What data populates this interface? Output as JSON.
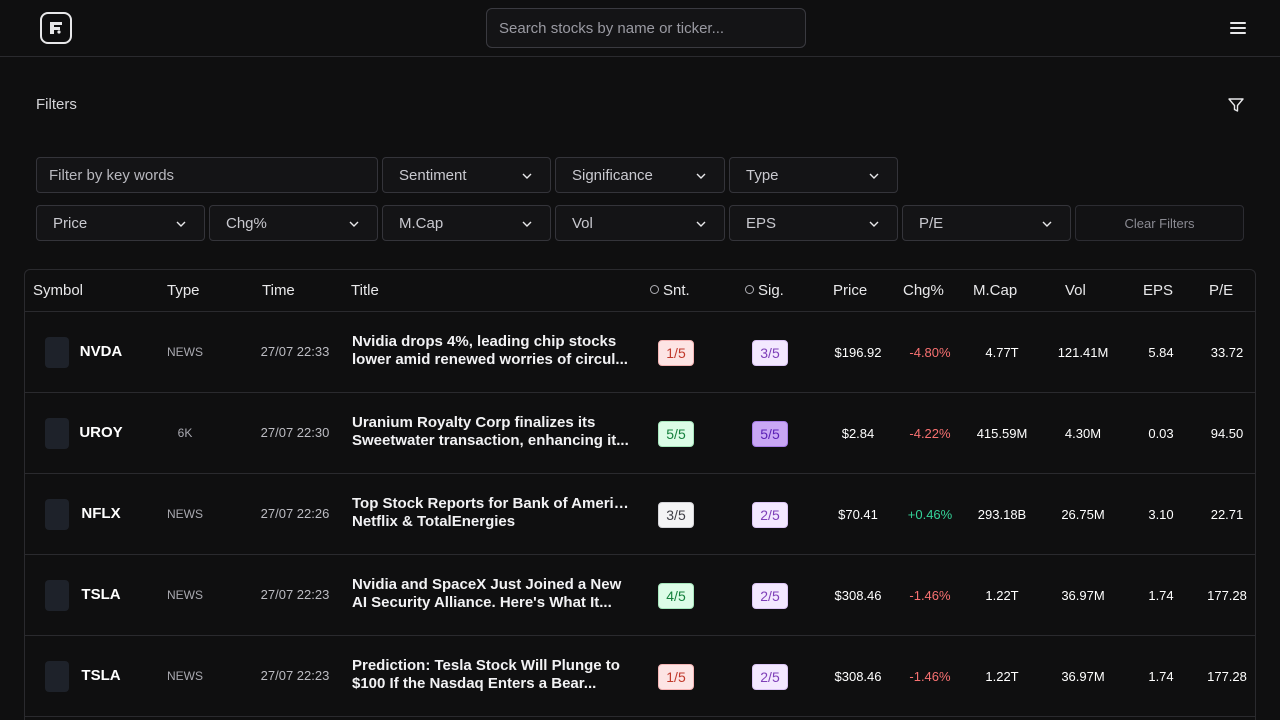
{
  "header": {
    "search_placeholder": "Search stocks by name or ticker...",
    "logo_icon": "app-logo-icon",
    "menu_icon": "hamburger-menu-icon"
  },
  "filters": {
    "title": "Filters",
    "keyword_placeholder": "Filter by key words",
    "dropdowns_row1": [
      "Sentiment",
      "Significance",
      "Type"
    ],
    "dropdowns_row2": [
      "Price",
      "Chg%",
      "M.Cap",
      "Vol",
      "EPS",
      "P/E"
    ],
    "clear_label": "Clear Filters"
  },
  "table": {
    "columns": [
      "Symbol",
      "Type",
      "Time",
      "Title",
      "Snt.",
      "Sig.",
      "Price",
      "Chg%",
      "M.Cap",
      "Vol",
      "EPS",
      "P/E"
    ],
    "rows": [
      {
        "symbol": "NVDA",
        "type": "NEWS",
        "time": "27/07 22:33",
        "title1": "Nvidia drops 4%, leading chip stocks",
        "title2": "lower amid renewed worries of circul...",
        "snt": "1/5",
        "sig": "3/5",
        "price": "$196.92",
        "chg": "-4.80%",
        "mcap": "4.77T",
        "vol": "121.41M",
        "eps": "5.84",
        "pe": "33.72"
      },
      {
        "symbol": "UROY",
        "type": "6K",
        "time": "27/07 22:30",
        "title1": "Uranium Royalty Corp finalizes its",
        "title2": "Sweetwater transaction, enhancing it...",
        "snt": "5/5",
        "sig": "5/5",
        "price": "$2.84",
        "chg": "-4.22%",
        "mcap": "415.59M",
        "vol": "4.30M",
        "eps": "0.03",
        "pe": "94.50"
      },
      {
        "symbol": "NFLX",
        "type": "NEWS",
        "time": "27/07 22:26",
        "title1": "Top Stock Reports for Bank of America,",
        "title2": "Netflix & TotalEnergies",
        "snt": "3/5",
        "sig": "2/5",
        "price": "$70.41",
        "chg": "+0.46%",
        "mcap": "293.18B",
        "vol": "26.75M",
        "eps": "3.10",
        "pe": "22.71"
      },
      {
        "symbol": "TSLA",
        "type": "NEWS",
        "time": "27/07 22:23",
        "title1": "Nvidia and SpaceX Just Joined a New",
        "title2": "AI Security Alliance. Here's What It...",
        "snt": "4/5",
        "sig": "2/5",
        "price": "$308.46",
        "chg": "-1.46%",
        "mcap": "1.22T",
        "vol": "36.97M",
        "eps": "1.74",
        "pe": "177.28"
      },
      {
        "symbol": "TSLA",
        "type": "NEWS",
        "time": "27/07 22:23",
        "title1": "Prediction: Tesla Stock Will Plunge to",
        "title2": "$100 If the Nasdaq Enters a Bear...",
        "snt": "1/5",
        "sig": "2/5",
        "price": "$308.46",
        "chg": "-1.46%",
        "mcap": "1.22T",
        "vol": "36.97M",
        "eps": "1.74",
        "pe": "177.28"
      }
    ]
  }
}
